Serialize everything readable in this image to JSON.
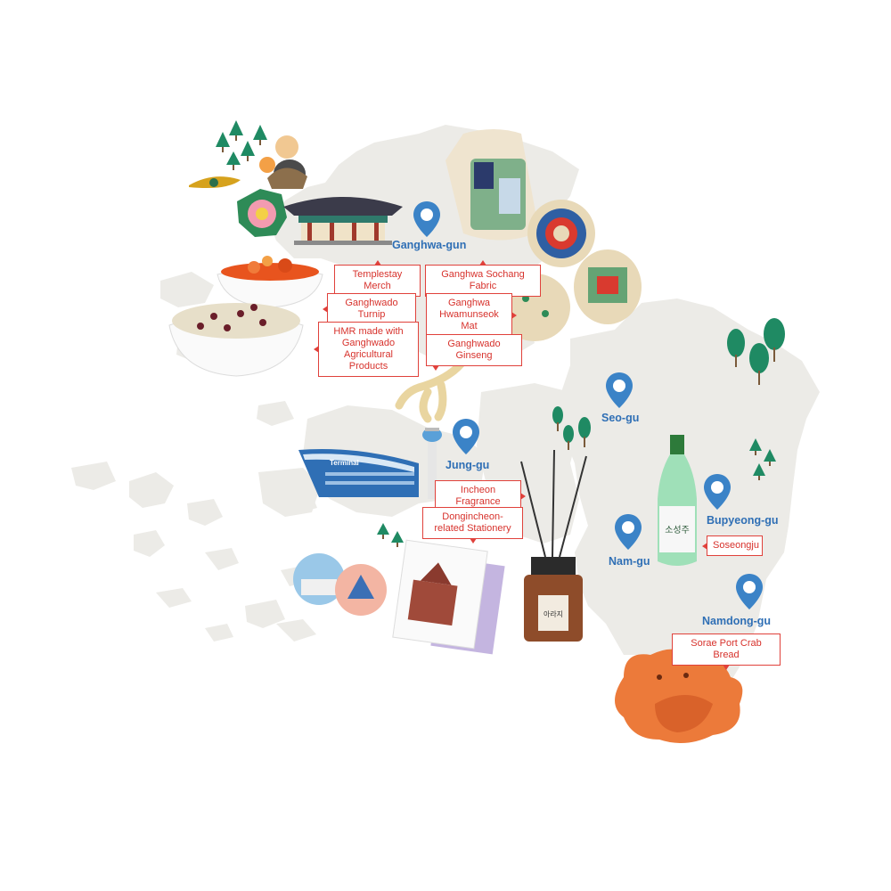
{
  "colors": {
    "land": "#ecebe7",
    "pin": "#3b83c7",
    "district_text": "#2f6fb5",
    "tag_border": "#e0413b",
    "tag_text": "#d7322c",
    "tree": "#1f8a63"
  },
  "districts": {
    "ganghwa": "Ganghwa-gun",
    "seo": "Seo-gu",
    "jung": "Jung-gu",
    "bupyeong": "Bupyeong-gu",
    "nam": "Nam-gu",
    "namdong": "Namdong-gu"
  },
  "products": {
    "templestay": "Templestay Merch",
    "sochang": "Ganghwa Sochang Fabric",
    "turnip": "Ganghwado Turnip",
    "hwamunseok": "Ganghwa Hwamunseok Mat",
    "hmr": "HMR made with Ganghwado Agricultural Products",
    "ginseng": "Ganghwado Ginseng",
    "fragrance": "Incheon Fragrance",
    "stationery": "Dongincheon-related Stationery",
    "soseongju": "Soseongju",
    "crab_bread": "Sorae Port Crab Bread"
  },
  "illustration_text": {
    "terminal_sign": "Terminal",
    "diffuser_label": "아라지",
    "bottle_label": "소성주"
  },
  "icons": [
    "location-pin-icon",
    "tree-icon",
    "temple-icon",
    "monk-icon",
    "ginseng-icon",
    "airport-terminal-icon",
    "control-tower-icon",
    "diffuser-icon",
    "makgeolli-bottle-icon",
    "crab-bread-icon",
    "fabric-pouch-icon",
    "woven-box-icon",
    "rice-bowl-icon",
    "kimchi-bowl-icon",
    "postcard-icon",
    "badge-icon"
  ]
}
